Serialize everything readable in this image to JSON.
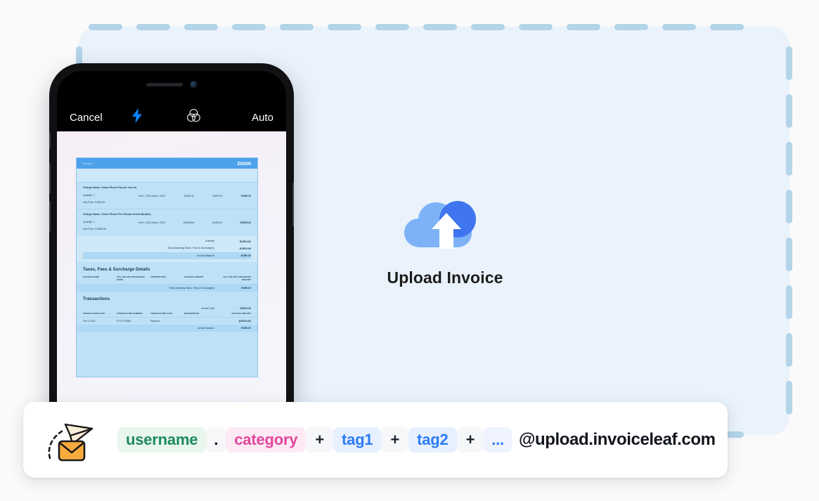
{
  "dropzone": {
    "label": "invoice-dropzone"
  },
  "upload": {
    "icon": "cloud-upload-icon",
    "label": "Upload Invoice"
  },
  "phone": {
    "camera": {
      "cancel_label": "Cancel",
      "flash_icon": "flash-bolt-icon",
      "filters_icon": "camera-filters-icon",
      "auto_label": "Auto"
    },
    "document": {
      "header": {
        "left": "Invoice",
        "logo": "zoom"
      },
      "line_items": [
        {
          "title": "Charge Name: Zoom Phone Pay As You Go",
          "quantity": "Quantity: 1",
          "unit_price": "Unit Price: EUR0.00",
          "period": "Feb 1, 2023–Mar 4, 2023",
          "amount1": "EUR0.00",
          "amount2": "EUR0.00",
          "amount3": "EUR0.00"
        },
        {
          "title": "Charge Name: Zoom Phone Pro Global Select Monthly",
          "quantity": "Quantity: 1",
          "unit_price": "Unit Price: EUR58.60",
          "period": "Feb 1, 2023–Mar 4, 2023",
          "amount1": "EUR58.60",
          "amount2": "EUR0.00",
          "amount3": "EUR58.60"
        }
      ],
      "summary": [
        {
          "label": "Subtotal",
          "value": "EUR24.60"
        },
        {
          "label": "Total (Including Taxes, Fees & Surcharges)",
          "value": "EUR24.60"
        },
        {
          "label": "Invoice Balance",
          "value": "EUR0.00",
          "highlight": true
        }
      ],
      "taxes_section": {
        "title": "Taxes, Fees & Surcharge Details",
        "columns": [
          "CHARGE NAME",
          "TAX, FEE OR SURCHARGE NAME",
          "JURISDICTION",
          "CHARGE AMOUNT",
          "TAX, FEE OR SURCHARGE AMOUNT"
        ],
        "total_label": "Total (Including Taxes, Fees & Surcharges)",
        "total_value": "EUR0.00"
      },
      "transactions_section": {
        "title": "Transactions",
        "invoice_total_label": "Invoice Total",
        "invoice_total_value": "EUR24.60",
        "columns": [
          "TRANSACTION DATE",
          "TRANSACTION NUMBER",
          "TRANSACTION TYPE",
          "DESCRIPTION",
          "APPLIED AMOUNT"
        ],
        "rows": [
          {
            "date": "Feb 3, 2023",
            "number": "P-21770166A",
            "type": "Payment",
            "description": "",
            "amount": "(EUR24.60)"
          }
        ],
        "balance_label": "Invoice Balance",
        "balance_value": "EUR0.00"
      }
    }
  },
  "email_bar": {
    "icon": "send-to-email-icon",
    "parts": [
      {
        "kind": "username",
        "text": "username"
      },
      {
        "kind": "dot",
        "text": "."
      },
      {
        "kind": "category",
        "text": "category"
      },
      {
        "kind": "plus",
        "text": "+"
      },
      {
        "kind": "tag",
        "text": "tag1"
      },
      {
        "kind": "plus",
        "text": "+"
      },
      {
        "kind": "tag",
        "text": "tag2"
      },
      {
        "kind": "plus",
        "text": "+"
      },
      {
        "kind": "ellipsis",
        "text": "..."
      }
    ],
    "domain": "@upload.invoiceleaf.com"
  },
  "colors": {
    "dropzone_fill": "#eaf2fb",
    "dash": "#b3d4e9",
    "cloud_light": "#7db2f7",
    "cloud_dark": "#3f75ef",
    "username": "#1d8a5a",
    "category": "#e1479d",
    "tag": "#2b7cf6",
    "envelope": "#f5a623"
  }
}
